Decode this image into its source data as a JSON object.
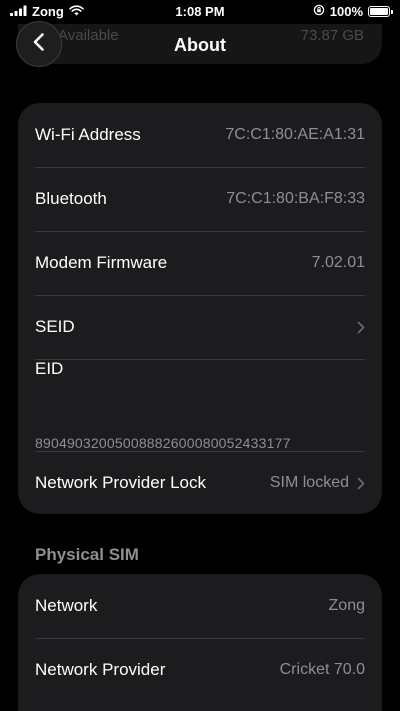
{
  "status_bar": {
    "carrier": "Zong",
    "time": "1:08 PM",
    "battery_percent": "100%",
    "battery_level": 1.0
  },
  "nav": {
    "title": "About",
    "behind_row_label": "Available",
    "behind_row_value": "73.87 GB"
  },
  "about_rows": [
    {
      "label": "Wi-Fi Address",
      "value": "7C:C1:80:AE:A1:31"
    },
    {
      "label": "Bluetooth",
      "value": "7C:C1:80:BA:F8:33"
    },
    {
      "label": "Modem Firmware",
      "value": "7.02.01"
    },
    {
      "label": "SEID",
      "value": ""
    },
    {
      "label": "EID",
      "value": "89049032005008882600080052433177"
    },
    {
      "label": "Network Provider Lock",
      "value": "SIM locked"
    }
  ],
  "physical_sim": {
    "header": "Physical SIM",
    "rows": [
      {
        "label": "Network",
        "value": "Zong"
      },
      {
        "label": "Network Provider",
        "value": "Cricket 70.0"
      }
    ]
  },
  "icons": {
    "wifi": "wifi-icon",
    "rotation_lock": "rotation-lock-icon",
    "battery": "battery-icon",
    "back": "chevron-left-icon",
    "disclosure": "chevron-right-icon"
  },
  "colors": {
    "background": "#000000",
    "card": "#1c1c1e",
    "secondary_text": "#8e8e93",
    "separator": "#38383a"
  }
}
